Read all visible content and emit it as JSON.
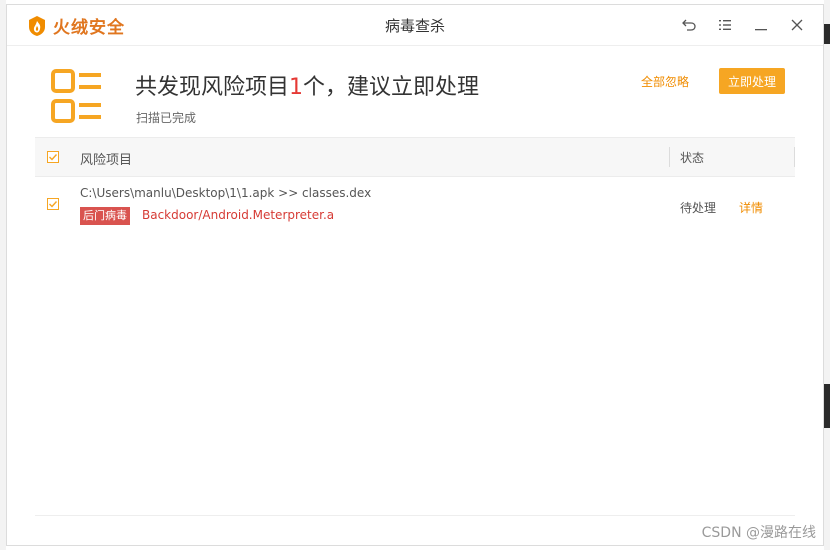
{
  "app": {
    "brand": "火绒安全",
    "window_title": "病毒查杀"
  },
  "controls": {
    "back_icon": "undo-icon",
    "menu_icon": "menu-icon",
    "minimize_icon": "minimize-icon",
    "close_icon": "close-icon"
  },
  "summary": {
    "title_prefix": "共发现风险项目",
    "count": "1",
    "title_suffix": "个，建议立即处理",
    "status": "扫描已完成",
    "ignore_all": "全部忽略",
    "fix_now": "立即处理"
  },
  "table": {
    "col_item": "风险项目",
    "col_status": "状态",
    "rows": [
      {
        "path": "C:\\Users\\manlu\\Desktop\\1\\1.apk >> classes.dex",
        "badge": "后门病毒",
        "virus": "Backdoor/Android.Meterpreter.a",
        "status": "待处理",
        "detail": "详情"
      }
    ]
  },
  "watermark": "CSDN @漫路在线",
  "colors": {
    "accent": "#f6a623",
    "brand": "#e0761f",
    "danger": "#d63b35"
  }
}
